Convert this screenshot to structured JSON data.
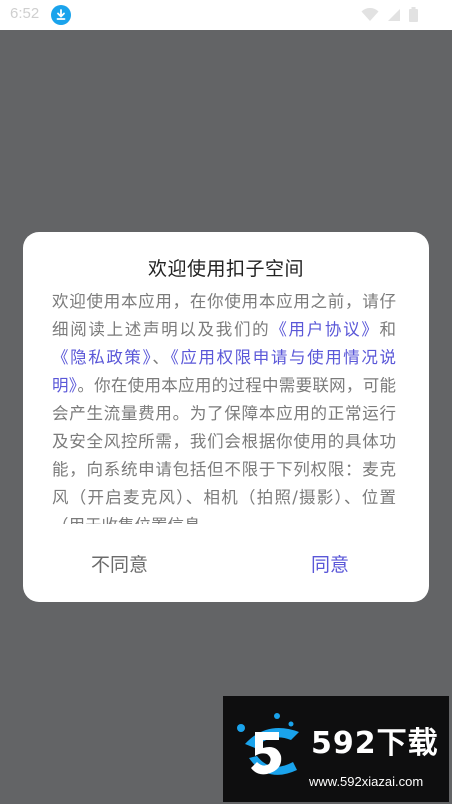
{
  "status_bar": {
    "time": "6:52",
    "icons": [
      "download-icon",
      "wifi-icon",
      "signal-icon",
      "battery-icon"
    ]
  },
  "dialog": {
    "title": "欢迎使用扣子空间",
    "body": {
      "p1": "欢迎使用本应用，在你使用本应用之前，请仔细阅读上述声明以及我们的",
      "link1": "《用户协议》",
      "and": "和",
      "link2": "《隐私政策》",
      "sep": "、",
      "link3": "《应用权限申请与使用情况说明》",
      "p2": "。你在使用本应用的过程中需要联网，可能会产生流量费用。为了保障本应用的正常运行及安全风控所需，我们会根据你使用的具体功能，向系统申请包括但不限于下列权限：麦克风（开启麦克风）、相机（拍照/摄影）、位置（用于收集位置信息、"
    },
    "buttons": {
      "disagree": "不同意",
      "agree": "同意"
    }
  },
  "watermark": {
    "brand": "592下载",
    "url": "www.592xiazai.com"
  },
  "colors": {
    "overlay": "#636466",
    "accent": "#5a57d8",
    "download_icon": "#1aa3ec"
  }
}
